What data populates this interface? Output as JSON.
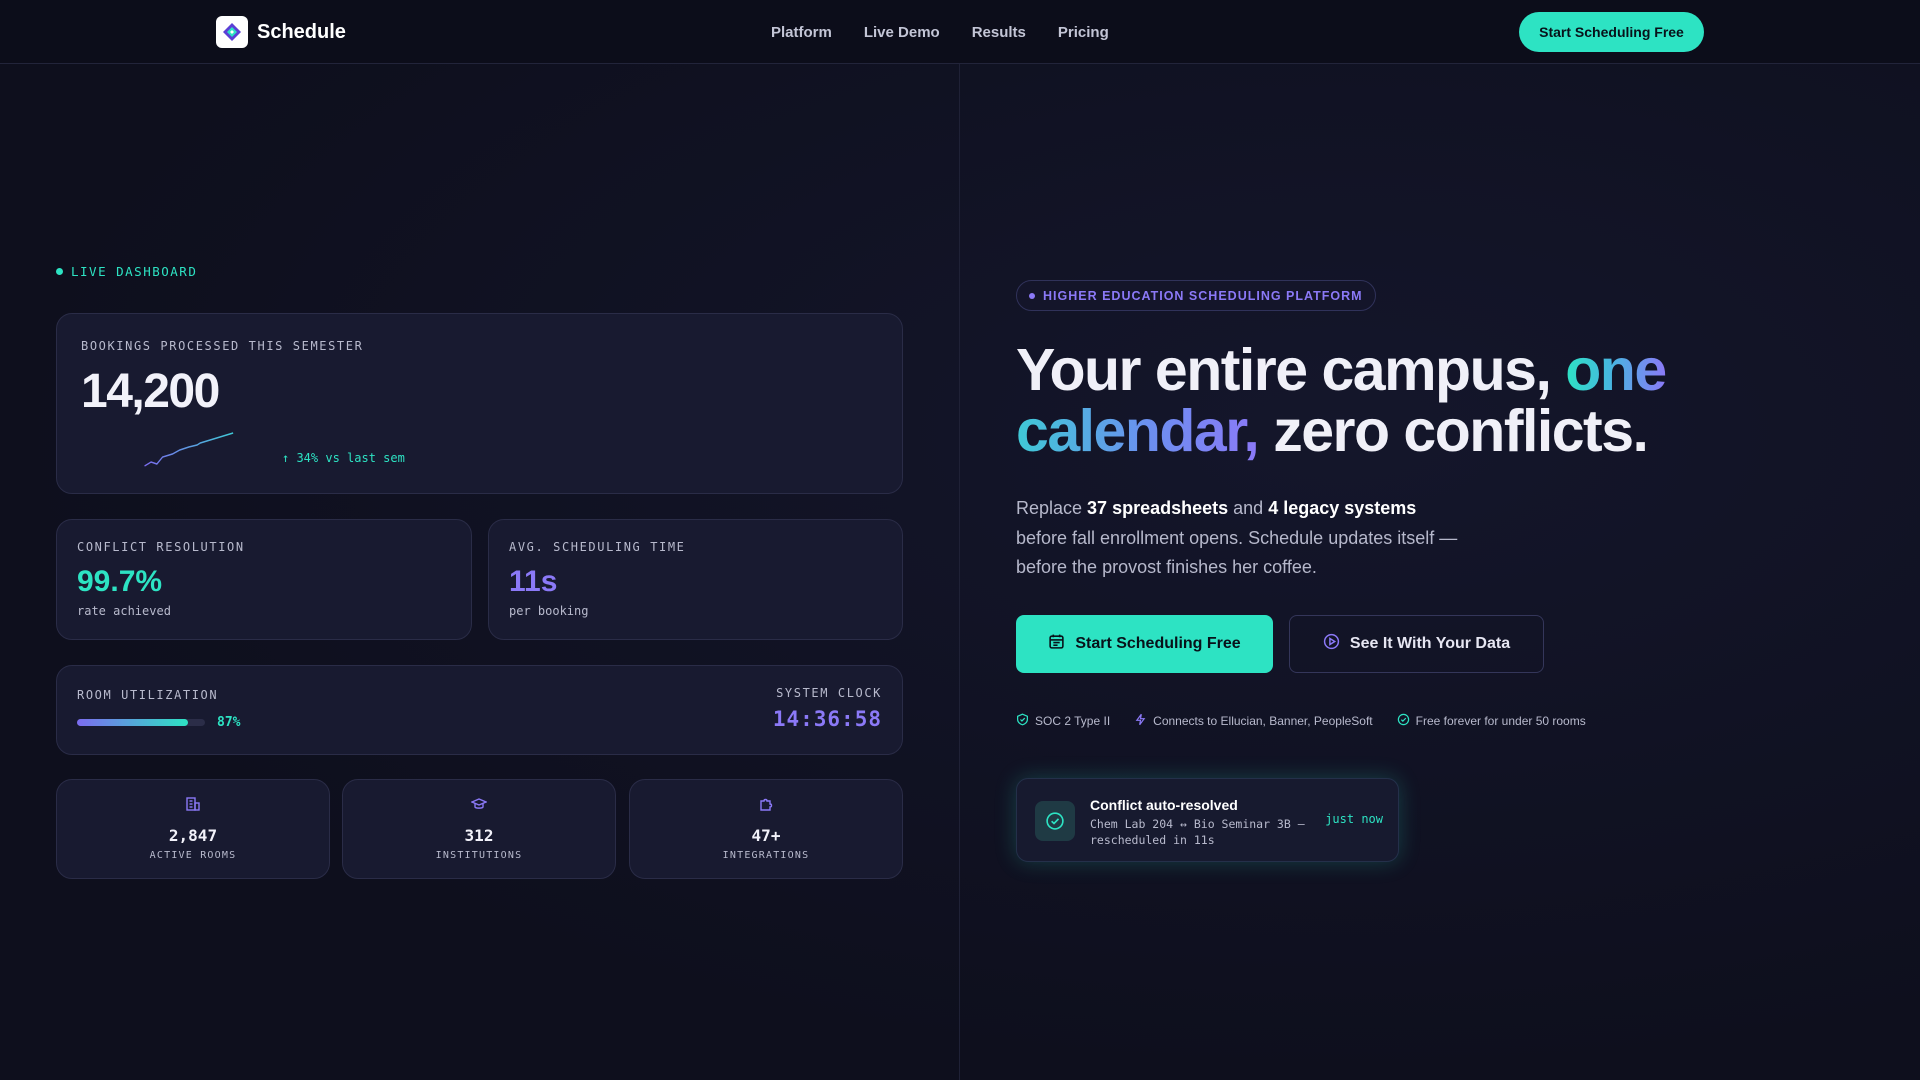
{
  "nav": {
    "brand": "Schedule",
    "links": [
      "Platform",
      "Live Demo",
      "Results",
      "Pricing"
    ],
    "cta": "Start Scheduling Free"
  },
  "dashboard": {
    "live_label": "LIVE DASHBOARD",
    "bookings": {
      "label": "BOOKINGS PROCESSED THIS SEMESTER",
      "value": "14,200",
      "trend": "↑ 34% vs last sem"
    },
    "conflict": {
      "label": "CONFLICT RESOLUTION",
      "value": "99.7%",
      "sub": "rate achieved"
    },
    "avg_time": {
      "label": "AVG. SCHEDULING TIME",
      "value": "11s",
      "sub": "per booking"
    },
    "room": {
      "label": "ROOM UTILIZATION",
      "percent_text": "87%",
      "fill_fraction": 0.87
    },
    "clock": {
      "label": "SYSTEM CLOCK",
      "value": "14:36:58"
    },
    "stats": [
      {
        "icon": "building-icon",
        "value": "2,847",
        "label": "ACTIVE ROOMS"
      },
      {
        "icon": "graduation-cap-icon",
        "value": "312",
        "label": "INSTITUTIONS"
      },
      {
        "icon": "puzzle-icon",
        "value": "47+",
        "label": "INTEGRATIONS"
      }
    ]
  },
  "hero": {
    "pill": "HIGHER EDUCATION SCHEDULING PLATFORM",
    "headline": {
      "part1": "Your entire campus, ",
      "accent1": "one",
      "accent2": "calendar,",
      "part2": " zero conflicts."
    },
    "sub": {
      "t1": "Replace ",
      "b1": "37 spreadsheets",
      "t2": " and ",
      "b2": "4 legacy systems",
      "t3": "before fall enrollment opens. Schedule updates itself —",
      "t4": "before the provost finishes her coffee."
    },
    "primary_button": "Start Scheduling Free",
    "secondary_button": "See It With Your Data",
    "badges": [
      {
        "icon": "shield-check-icon",
        "label": "SOC 2 Type II"
      },
      {
        "icon": "lightning-icon",
        "label": "Connects to Ellucian, Banner, PeopleSoft"
      },
      {
        "icon": "check-circle-icon",
        "label": "Free forever for under 50 rooms"
      }
    ],
    "toast": {
      "title": "Conflict auto-resolved",
      "body": "Chem Lab 204 ↔ Bio Seminar 3B — rescheduled in 11s",
      "time": "just now"
    }
  },
  "colors": {
    "accent_teal": "#2de3c3",
    "accent_purple": "#8b79f7",
    "background": "#0f1020",
    "card": "#181a30"
  }
}
